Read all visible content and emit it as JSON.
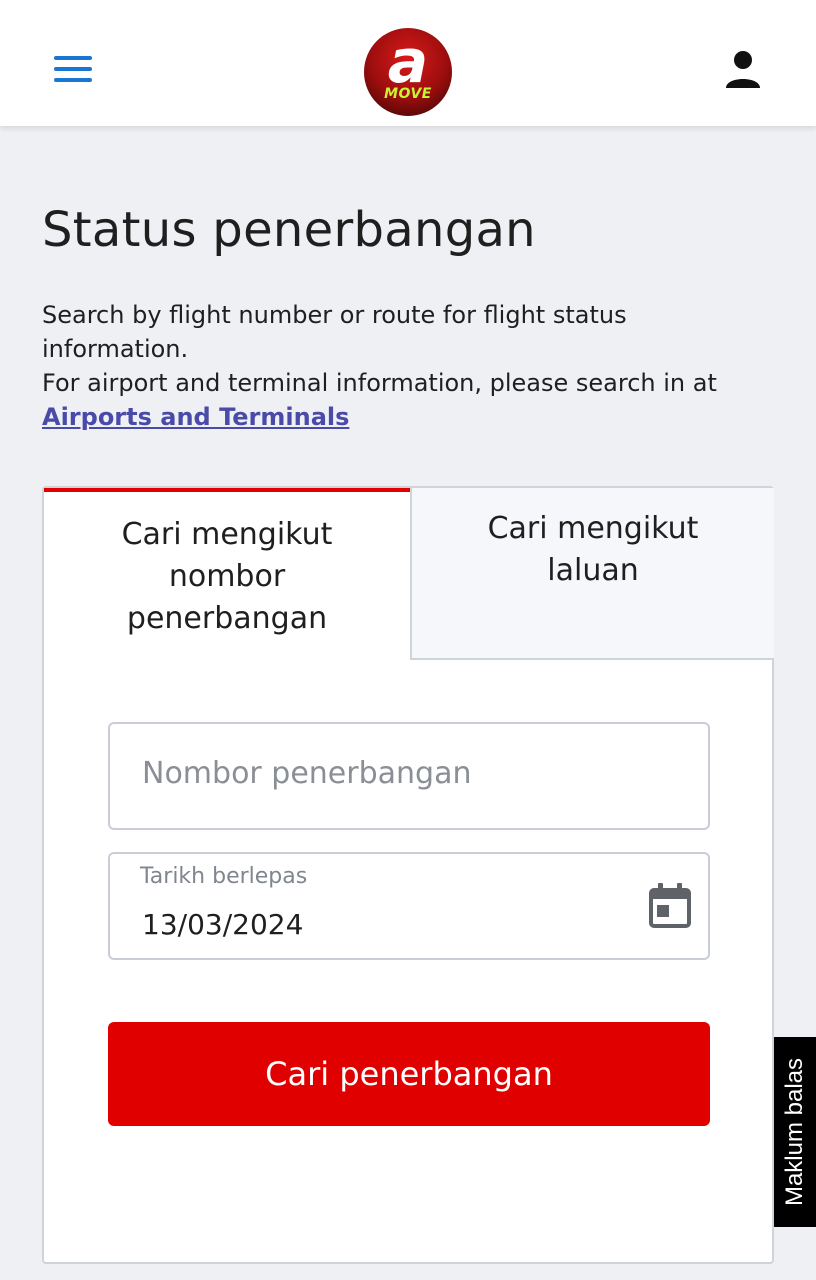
{
  "header": {
    "menu_icon": "hamburger-menu-icon",
    "logo": {
      "letter": "a",
      "text": "MOVE"
    },
    "profile_icon": "user-icon",
    "colors": {
      "menu": "#1976d2",
      "logo_red": "#d91a1a",
      "logo_green": "#c6f432"
    }
  },
  "page": {
    "title": "Status penerbangan",
    "description_line1": "Search by flight number or route for flight status information.",
    "description_line2": "For airport and terminal information, please search in at",
    "airports_link": "Airports and Terminals"
  },
  "tabs": [
    {
      "label": "Cari mengikut nombor penerbangan",
      "active": true
    },
    {
      "label": "Cari mengikut laluan",
      "active": false
    }
  ],
  "form": {
    "flight_number": {
      "placeholder": "Nombor penerbangan",
      "value": ""
    },
    "departure_date": {
      "label": "Tarikh berlepas",
      "value": "13/03/2024",
      "icon": "calendar-icon"
    },
    "search_button": "Cari penerbangan"
  },
  "feedback_tab": "Maklum balas",
  "colors": {
    "accent": "#e10000",
    "link": "#4a4aa8",
    "background": "#eef0f3"
  }
}
